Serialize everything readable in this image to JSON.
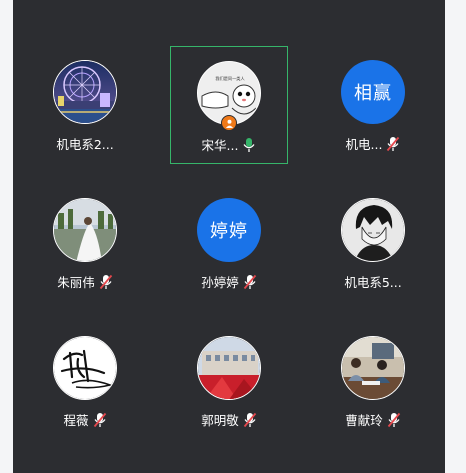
{
  "participants": [
    {
      "name": "机电系2...",
      "avatar_type": "photo",
      "avatar_desc": "ferris-wheel-night",
      "mic": "none"
    },
    {
      "name": "宋华...",
      "avatar_type": "photo",
      "avatar_desc": "cartoon-fist-bump",
      "mic": "on",
      "host": true,
      "active_speaker": true,
      "avatar_caption": "我们是同一类人"
    },
    {
      "name": "机电...",
      "avatar_type": "text",
      "avatar_text": "相赢",
      "mic": "muted"
    },
    {
      "name": "朱丽伟",
      "avatar_type": "photo",
      "avatar_desc": "bride-photo",
      "mic": "muted"
    },
    {
      "name": "孙婷婷",
      "avatar_type": "text",
      "avatar_text": "婷婷",
      "mic": "muted"
    },
    {
      "name": "机电系5...",
      "avatar_type": "photo",
      "avatar_desc": "anime-sketch",
      "mic": "none"
    },
    {
      "name": "程薇",
      "avatar_type": "photo",
      "avatar_desc": "calligraphy-signature",
      "mic": "muted"
    },
    {
      "name": "郭明敬",
      "avatar_type": "photo",
      "avatar_desc": "red-building",
      "mic": "muted"
    },
    {
      "name": "曹献玲",
      "avatar_type": "photo",
      "avatar_desc": "office-meeting",
      "mic": "muted"
    }
  ],
  "colors": {
    "panel_bg": "#2c2d31",
    "text_avatar_bg": "#1a73e8",
    "active_border": "#36b56a",
    "mic_on": "#36b56a",
    "mic_muted": "#e5484d",
    "host_badge": "#f07a1a"
  },
  "icons": {
    "mic_on": "microphone-icon",
    "mic_muted": "microphone-muted-icon",
    "host": "host-person-icon"
  }
}
